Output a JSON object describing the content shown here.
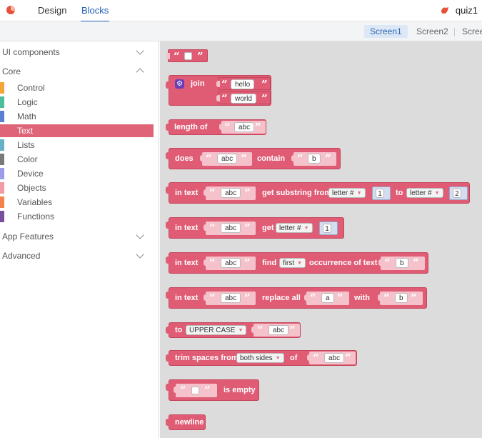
{
  "topbar": {
    "tabs": [
      "Design",
      "Blocks"
    ],
    "project_name": "quiz1"
  },
  "screens": [
    "Screen1",
    "Screen2",
    "Scree"
  ],
  "sidebar": {
    "ui_components": "UI components",
    "core": "Core",
    "items": [
      {
        "label": "Control",
        "color": "#f4a535"
      },
      {
        "label": "Logic",
        "color": "#4dbd9b"
      },
      {
        "label": "Math",
        "color": "#5b7fd0"
      },
      {
        "label": "Text",
        "color": "#df6478"
      },
      {
        "label": "Lists",
        "color": "#64b2c8"
      },
      {
        "label": "Color",
        "color": "#7a7a7a"
      },
      {
        "label": "Device",
        "color": "#9c9ce8"
      },
      {
        "label": "Objects",
        "color": "#f29aa6"
      },
      {
        "label": "Variables",
        "color": "#f5824b"
      },
      {
        "label": "Functions",
        "color": "#7a4fa0"
      }
    ],
    "app_features": "App Features",
    "advanced": "Advanced"
  },
  "blocks": {
    "join": {
      "label": "join",
      "a": "hello",
      "b": "world"
    },
    "length": {
      "label": "length of",
      "s": "abc"
    },
    "contains": {
      "does": "does",
      "s": "abc",
      "contain": "contain",
      "b": "b"
    },
    "substring": {
      "in_text": "in text",
      "s": "abc",
      "label": "get substring from",
      "from_dd": "letter #",
      "from_num": "1",
      "to": "to",
      "to_dd": "letter #",
      "to_num": "2"
    },
    "char_at": {
      "in_text": "in text",
      "s": "abc",
      "get": "get",
      "dd": "letter #",
      "num": "1"
    },
    "find": {
      "in_text": "in text",
      "s": "abc",
      "find": "find",
      "dd": "first",
      "occ": "occurrence of text",
      "b": "b"
    },
    "replace": {
      "in_text": "in text",
      "s": "abc",
      "label": "replace all",
      "a": "a",
      "with": "with",
      "b": "b"
    },
    "case": {
      "to": "to",
      "dd": "UPPER CASE",
      "s": "abc"
    },
    "trim": {
      "label": "trim spaces from",
      "dd": "both sides",
      "of": "of",
      "s": "abc"
    },
    "empty": {
      "label": "is empty"
    },
    "newline": {
      "label": "newline"
    }
  },
  "colors": {
    "text_block": "#df5c74",
    "accent": "#1f5fb4"
  }
}
